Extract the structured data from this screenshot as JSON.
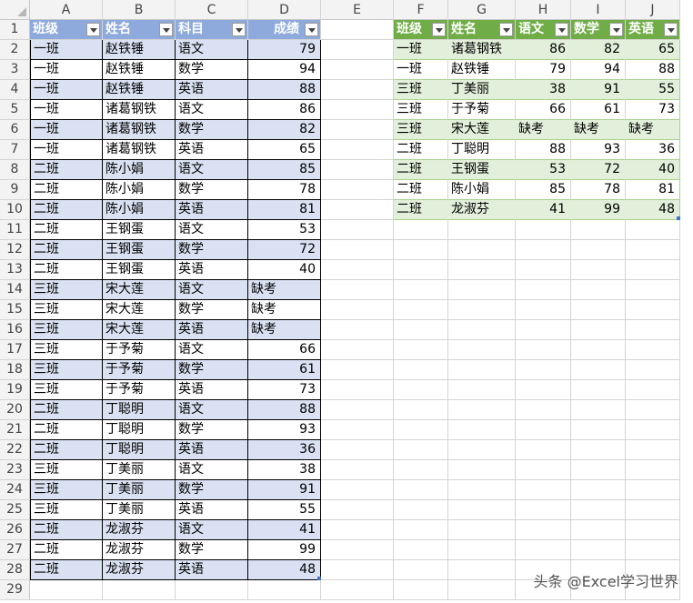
{
  "columns": [
    "A",
    "B",
    "C",
    "D",
    "E",
    "F",
    "G",
    "H",
    "I",
    "J"
  ],
  "left_table": {
    "headers": [
      "班级",
      "姓名",
      "科目",
      "成绩"
    ],
    "rows": [
      [
        "一班",
        "赵铁锤",
        "语文",
        "79"
      ],
      [
        "一班",
        "赵铁锤",
        "数学",
        "94"
      ],
      [
        "一班",
        "赵铁锤",
        "英语",
        "88"
      ],
      [
        "一班",
        "诸葛钢铁",
        "语文",
        "86"
      ],
      [
        "一班",
        "诸葛钢铁",
        "数学",
        "82"
      ],
      [
        "一班",
        "诸葛钢铁",
        "英语",
        "65"
      ],
      [
        "二班",
        "陈小娟",
        "语文",
        "85"
      ],
      [
        "二班",
        "陈小娟",
        "数学",
        "78"
      ],
      [
        "二班",
        "陈小娟",
        "英语",
        "81"
      ],
      [
        "二班",
        "王钢蛋",
        "语文",
        "53"
      ],
      [
        "二班",
        "王钢蛋",
        "数学",
        "72"
      ],
      [
        "二班",
        "王钢蛋",
        "英语",
        "40"
      ],
      [
        "三班",
        "宋大莲",
        "语文",
        "缺考"
      ],
      [
        "三班",
        "宋大莲",
        "数学",
        "缺考"
      ],
      [
        "三班",
        "宋大莲",
        "英语",
        "缺考"
      ],
      [
        "三班",
        "于予菊",
        "语文",
        "66"
      ],
      [
        "三班",
        "于予菊",
        "数学",
        "61"
      ],
      [
        "三班",
        "于予菊",
        "英语",
        "73"
      ],
      [
        "二班",
        "丁聪明",
        "语文",
        "88"
      ],
      [
        "二班",
        "丁聪明",
        "数学",
        "93"
      ],
      [
        "二班",
        "丁聪明",
        "英语",
        "36"
      ],
      [
        "三班",
        "丁美丽",
        "语文",
        "38"
      ],
      [
        "三班",
        "丁美丽",
        "数学",
        "91"
      ],
      [
        "三班",
        "丁美丽",
        "英语",
        "55"
      ],
      [
        "二班",
        "龙淑芬",
        "语文",
        "41"
      ],
      [
        "二班",
        "龙淑芬",
        "数学",
        "99"
      ],
      [
        "二班",
        "龙淑芬",
        "英语",
        "48"
      ]
    ]
  },
  "right_table": {
    "headers": [
      "班级",
      "姓名",
      "语文",
      "数学",
      "英语"
    ],
    "rows": [
      [
        "一班",
        "诸葛钢铁",
        "86",
        "82",
        "65"
      ],
      [
        "一班",
        "赵铁锤",
        "79",
        "94",
        "88"
      ],
      [
        "三班",
        "丁美丽",
        "38",
        "91",
        "55"
      ],
      [
        "三班",
        "于予菊",
        "66",
        "61",
        "73"
      ],
      [
        "三班",
        "宋大莲",
        "缺考",
        "缺考",
        "缺考"
      ],
      [
        "二班",
        "丁聪明",
        "88",
        "93",
        "36"
      ],
      [
        "二班",
        "王钢蛋",
        "53",
        "72",
        "40"
      ],
      [
        "二班",
        "陈小娟",
        "85",
        "78",
        "81"
      ],
      [
        "二班",
        "龙淑芬",
        "41",
        "99",
        "48"
      ]
    ]
  },
  "watermark": "头条 @Excel学习世界",
  "colors": {
    "blue_header": "#8ea9db",
    "blue_band": "#d9e1f2",
    "green_header": "#70ad47",
    "green_band": "#e2efda"
  }
}
